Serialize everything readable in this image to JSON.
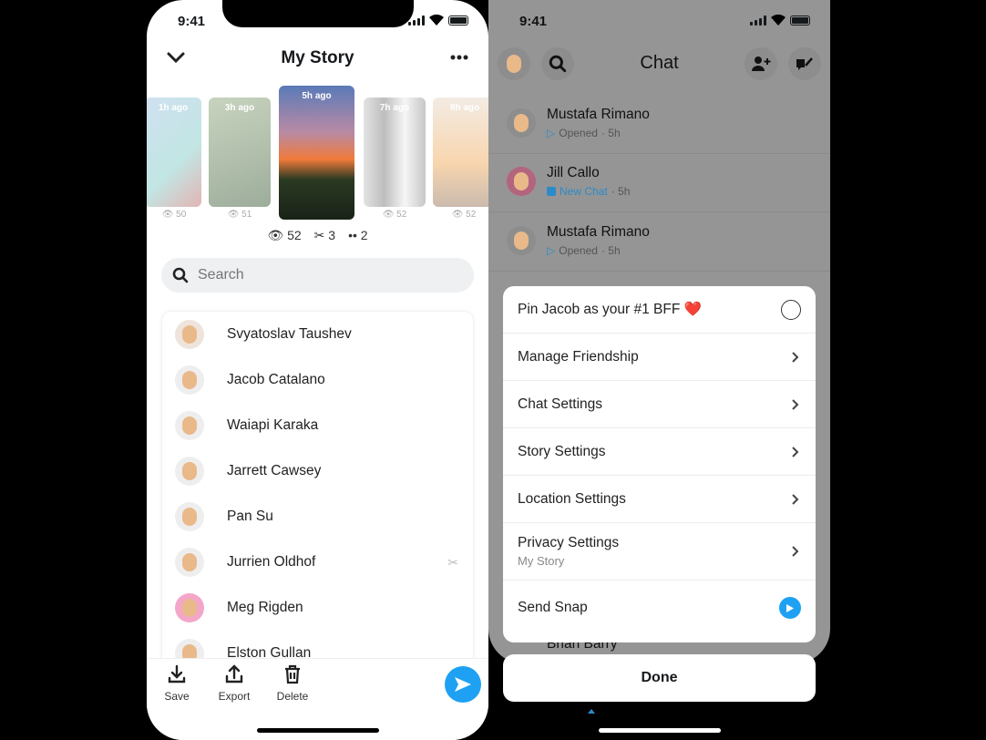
{
  "left": {
    "status": {
      "time": "9:41"
    },
    "header": {
      "title": "My Story",
      "back_icon": "chevron-down-icon",
      "more_icon": "more-horizontal-icon"
    },
    "snaps": [
      {
        "ago": "1h ago",
        "views": "50"
      },
      {
        "ago": "3h ago",
        "views": "51"
      },
      {
        "ago": "5h ago",
        "views": "",
        "selected": true
      },
      {
        "ago": "7h ago",
        "views": "52"
      },
      {
        "ago": "8h ago",
        "views": "52"
      }
    ],
    "stats": {
      "views": "52",
      "screenshots": "3",
      "replays": "2"
    },
    "search": {
      "placeholder": "Search"
    },
    "viewers": [
      {
        "name": "Svyatoslav Taushev"
      },
      {
        "name": "Jacob Catalano"
      },
      {
        "name": "Waiapi Karaka"
      },
      {
        "name": "Jarrett Cawsey"
      },
      {
        "name": "Pan Su"
      },
      {
        "name": "Jurrien Oldhof",
        "screenshot": true
      },
      {
        "name": "Meg Rigden"
      },
      {
        "name": "Elston Gullan"
      }
    ],
    "toolbar": {
      "save": "Save",
      "export": "Export",
      "delete": "Delete"
    },
    "accent": "#1ea1f2"
  },
  "right": {
    "status": {
      "time": "9:41"
    },
    "header": {
      "title": "Chat"
    },
    "chats": [
      {
        "name": "Mustafa Rimano",
        "status": "Opened",
        "time": "· 5h"
      },
      {
        "name": "Jill Callo",
        "status": "New Chat",
        "time": "· 5h"
      },
      {
        "name": "Mustafa Rimano",
        "status": "Opened",
        "time": "· 5h"
      }
    ],
    "behind_sheet_name": "Brian Barry",
    "sheet": {
      "pin": "Pin Jacob as your #1 BFF ❤️",
      "options": [
        "Manage Friendship",
        "Chat Settings",
        "Story Settings",
        "Location Settings"
      ],
      "privacy": {
        "label": "Privacy Settings",
        "sub": "My Story"
      },
      "send": "Send Snap"
    },
    "done": "Done"
  }
}
